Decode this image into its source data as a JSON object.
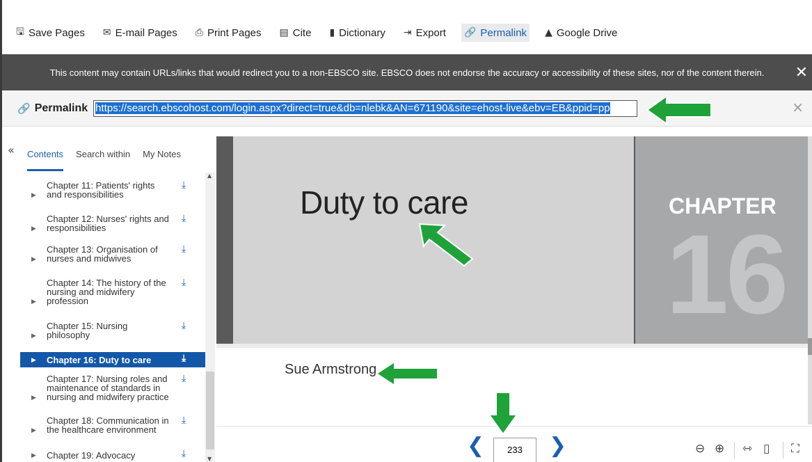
{
  "toolbar": {
    "items": [
      {
        "label": "Save Pages",
        "icon": "floppy-disk-icon"
      },
      {
        "label": "E-mail Pages",
        "icon": "envelope-icon"
      },
      {
        "label": "Print Pages",
        "icon": "printer-icon"
      },
      {
        "label": "Cite",
        "icon": "cite-icon"
      },
      {
        "label": "Dictionary",
        "icon": "book-icon"
      },
      {
        "label": "Export",
        "icon": "export-icon"
      },
      {
        "label": "Permalink",
        "icon": "link-icon",
        "active": true
      },
      {
        "label": "Google Drive",
        "icon": "google-drive-icon"
      }
    ]
  },
  "notice": {
    "text": "This content may contain URLs/links that would redirect you to a non-EBSCO site. EBSCO does not endorse the accuracy or accessibility of these sites, nor of the content therein.",
    "close": "✕"
  },
  "permalink": {
    "label": "Permalink",
    "url": "https://search.ebscohost.com/login.aspx?direct=true&db=nlebk&AN=671190&site=ehost-live&ebv=EB&ppid=pp",
    "close": "×"
  },
  "sidebar": {
    "tabs": [
      "Contents",
      "Search within",
      "My Notes"
    ],
    "collapse": "«",
    "toc": [
      {
        "lines": [
          "Chapter 11: Patients' rights",
          "and responsibilities"
        ]
      },
      {
        "lines": [
          "Chapter 12: Nurses' rights and",
          "responsibilities"
        ]
      },
      {
        "lines": [
          "Chapter 13: Organisation of",
          "nurses and midwives"
        ]
      },
      {
        "lines": [
          "Chapter 14: The history of the",
          "nursing and midwifery",
          "profession"
        ]
      },
      {
        "lines": [
          "Chapter 15: Nursing",
          "philosophy"
        ]
      },
      {
        "lines": [
          "Chapter 16: Duty to care"
        ],
        "active": true
      },
      {
        "lines": [
          "Chapter 17: Nursing roles and",
          "maintenance of standards in",
          "nursing and midwifery practice"
        ]
      },
      {
        "lines": [
          "Chapter 18: Communication in",
          "the healthcare environment"
        ]
      },
      {
        "lines": [
          "Chapter 19: Advocacy"
        ]
      }
    ]
  },
  "reader": {
    "title": "Duty to care",
    "chapter_label": "CHAPTER",
    "chapter_number": "16",
    "author": "Sue Armstrong",
    "page_number": "233"
  },
  "colors": {
    "accent": "#1b5fae",
    "notice_bg": "#4d4d4d",
    "toc_active_bg": "#1358a8",
    "annotation_arrow": "#1fa23a"
  }
}
